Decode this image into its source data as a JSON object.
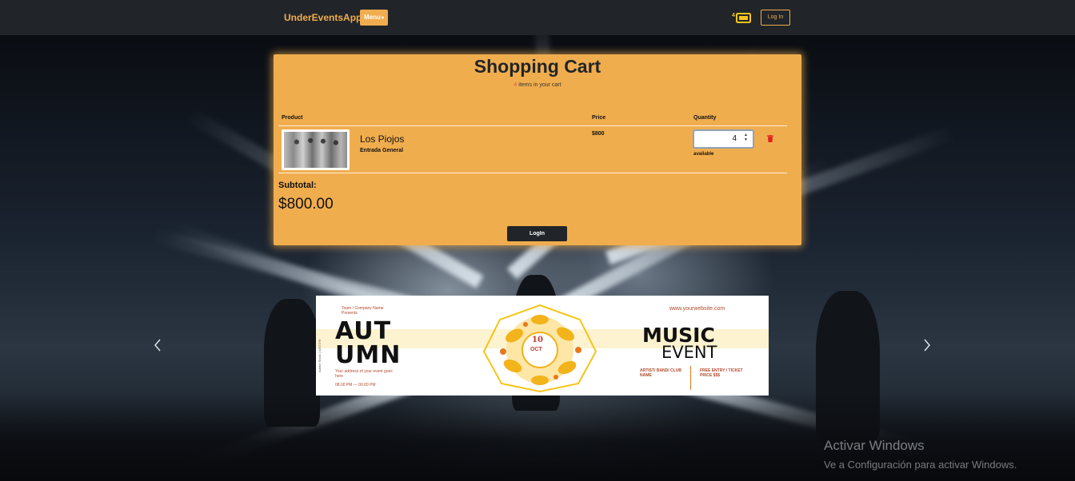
{
  "navbar": {
    "brand": "UnderEventsApp",
    "menu_label": "Menu",
    "cart_icon": "ticket-icon",
    "cart_badge": "4",
    "login_label": "Log In"
  },
  "cart": {
    "title": "Shopping Cart",
    "item_count": "4",
    "item_count_suffix": " items in your cart",
    "columns": {
      "product": "Product",
      "price": "Price",
      "quantity": "Quantity"
    },
    "items": [
      {
        "name": "Los Piojos",
        "ticket_type": "Entrada General",
        "price": "$800",
        "quantity": "4",
        "availability": "available"
      }
    ],
    "subtotal_label": "Subtotal:",
    "subtotal_value": "$800.00",
    "login_button": "LogIn"
  },
  "carousel": {
    "slide": {
      "company": "Team / Company Name",
      "presents": "Presents",
      "website": "www.yourwebsite.com",
      "title_line1": "AUT",
      "title_line2": "UMN",
      "address": "Your address of your event goes here",
      "time": "08.00 PM — 00.00 PM",
      "day": "10",
      "month": "OCT",
      "music": "MUSIC",
      "event": "EVENT",
      "artist": "ARTIST/ BAND/ CLUB NAME",
      "entry": "FREE ENTRY / TICKET PRICE $$$",
      "side_id": "Adobe Stock | #297276"
    },
    "prev_icon": "chevron-left-icon",
    "next_icon": "chevron-right-icon"
  },
  "watermark": {
    "line1": "Activar Windows",
    "line2": "Ve a Configuración para activar Windows."
  },
  "colors": {
    "accent": "#f0ad4e",
    "navbar": "#212529",
    "danger": "#d9534f"
  }
}
